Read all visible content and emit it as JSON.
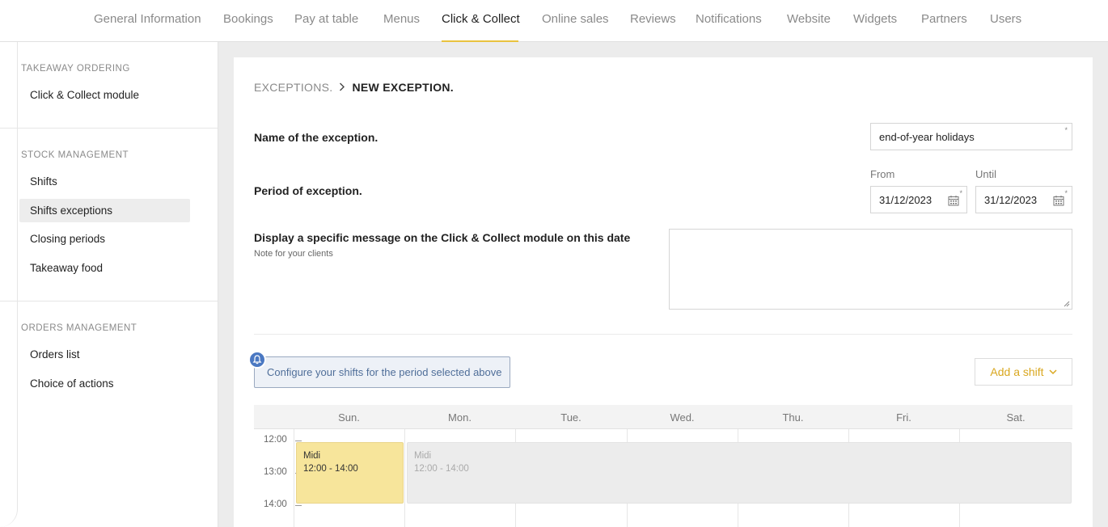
{
  "nav": {
    "tabs": [
      {
        "label": "General Information"
      },
      {
        "label": "Bookings"
      },
      {
        "label": "Pay at table"
      },
      {
        "label": "Menus"
      },
      {
        "label": "Click & Collect"
      },
      {
        "label": "Online sales"
      },
      {
        "label": "Reviews"
      },
      {
        "label": "Notifications"
      },
      {
        "label": "Website"
      },
      {
        "label": "Widgets"
      },
      {
        "label": "Partners"
      },
      {
        "label": "Users"
      }
    ],
    "active_tab": "Click & Collect"
  },
  "sidebar": {
    "sections": [
      {
        "title": "TAKEAWAY ORDERING",
        "items": [
          {
            "label": "Click & Collect module"
          }
        ]
      },
      {
        "title": "STOCK MANAGEMENT",
        "items": [
          {
            "label": "Shifts"
          },
          {
            "label": "Shifts exceptions"
          },
          {
            "label": "Closing periods"
          },
          {
            "label": "Takeaway food"
          }
        ]
      },
      {
        "title": "ORDERS MANAGEMENT",
        "items": [
          {
            "label": "Orders list"
          },
          {
            "label": "Choice of actions"
          }
        ]
      }
    ],
    "active_item": "Shifts exceptions"
  },
  "breadcrumb": {
    "parent": "EXCEPTIONS.",
    "current": "NEW EXCEPTION."
  },
  "form": {
    "name_label": "Name of the exception.",
    "name_value": "end-of-year holidays",
    "period_label": "Period of exception.",
    "from_label": "From",
    "from_value": "31/12/2023",
    "until_label": "Until",
    "until_value": "31/12/2023",
    "message_label": "Display a specific message on the Click & Collect module on this date",
    "message_note": "Note for your clients",
    "message_value": "",
    "required_mark": "*"
  },
  "shifts": {
    "info": "Configure your shifts for the period selected above",
    "add_button": "Add a shift"
  },
  "calendar": {
    "days": [
      "Sun.",
      "Mon.",
      "Tue.",
      "Wed.",
      "Thu.",
      "Fri.",
      "Sat."
    ],
    "times": [
      "12:00",
      "13:00",
      "14:00"
    ],
    "events": [
      {
        "name": "Midi",
        "time": "12:00 - 14:00",
        "state": "active"
      },
      {
        "name": "Midi",
        "time": "12:00 - 14:00",
        "state": "inactive"
      }
    ]
  },
  "colors": {
    "accent": "#e9c33f",
    "info_border": "#9aa9c0",
    "info_text": "#4f6e99",
    "bell": "#4a78c2",
    "event": "#f7e59b"
  }
}
